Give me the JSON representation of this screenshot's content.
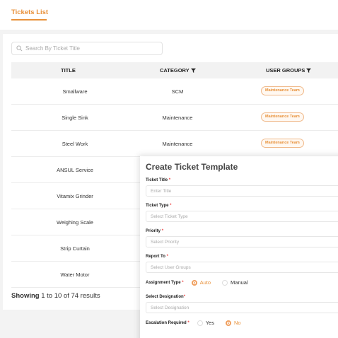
{
  "tabs": {
    "active": "Tickets List"
  },
  "search": {
    "placeholder": "Search By Ticket Title"
  },
  "table": {
    "headers": {
      "title": "TITLE",
      "category": "CATEGORY",
      "user_groups": "USER GROUPS"
    },
    "rows": [
      {
        "title": "Smallware",
        "category": "SCM",
        "group": "Maintenance Team"
      },
      {
        "title": "Single Sink",
        "category": "Maintenance",
        "group": "Maintenance Team"
      },
      {
        "title": "Steel Work",
        "category": "Maintenance",
        "group": "Maintenance Team"
      },
      {
        "title": "ANSUL Service"
      },
      {
        "title": "Vitamix Grinder"
      },
      {
        "title": "Weighing Scale"
      },
      {
        "title": "Strip Curtain"
      },
      {
        "title": "Water Motor"
      }
    ]
  },
  "footer": {
    "showing_label": "Showing",
    "range": "1 to 10 of 74 results"
  },
  "modal": {
    "title": "Create Ticket Template",
    "ticket_title": {
      "label": "Ticket Title",
      "placeholder": "Enter Title"
    },
    "ticket_type": {
      "label": "Ticket Type",
      "placeholder": "Select Ticket Type"
    },
    "priority": {
      "label": "Priority",
      "placeholder": "Select Priority"
    },
    "report_to": {
      "label": "Report To",
      "placeholder": "Select User Groups"
    },
    "assignment_type": {
      "label": "Assignment Type",
      "option_auto": "Auto",
      "option_manual": "Manual"
    },
    "designation": {
      "label": "Select Designation",
      "placeholder": "Select Designation"
    },
    "escalation": {
      "label": "Escalation Required",
      "option_yes": "Yes",
      "option_no": "No"
    },
    "required_mark": "*"
  },
  "colors": {
    "accent": "#e8913a",
    "required": "#ee4444"
  }
}
